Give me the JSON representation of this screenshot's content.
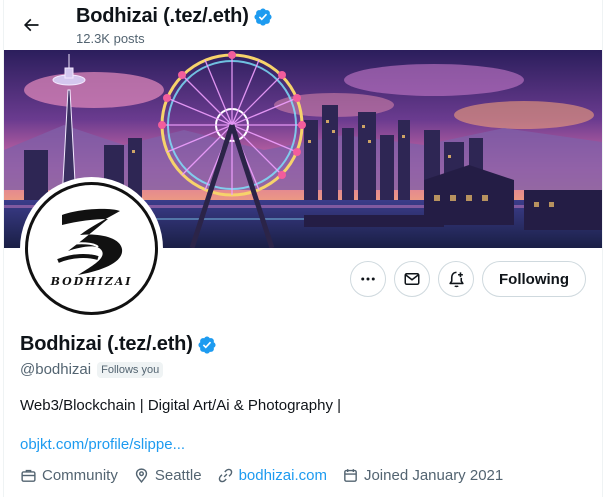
{
  "header": {
    "back_label": "Back",
    "title": "Bodhizai (.tez/.eth)",
    "posts_count": "12.3K posts"
  },
  "avatar": {
    "logo_text": "BODHIZAI"
  },
  "actions": {
    "more_label": "More",
    "message_label": "Message",
    "notify_label": "Turn on post notifications",
    "following_label": "Following"
  },
  "profile": {
    "name": "Bodhizai (.tez/.eth)",
    "handle": "@bodhizai",
    "follows_you": "Follows you",
    "bio": "Web3/Blockchain | Digital Art/Ai & Photography |",
    "bio_link": "objkt.com/profile/slippe...",
    "meta": {
      "category": "Community",
      "location": "Seattle",
      "website": "bodhizai.com",
      "joined": "Joined January 2021"
    }
  },
  "colors": {
    "verified": "#1d9bf0",
    "link": "#1d9bf0",
    "secondary_text": "#536471",
    "border": "#cfd9de"
  },
  "icons": {
    "back": "arrow-left-icon",
    "verified": "verified-badge-icon",
    "more": "ellipsis-icon",
    "message": "envelope-icon",
    "notify": "bell-plus-icon",
    "category": "briefcase-icon",
    "location": "map-pin-icon",
    "website": "link-icon",
    "joined": "calendar-icon"
  }
}
